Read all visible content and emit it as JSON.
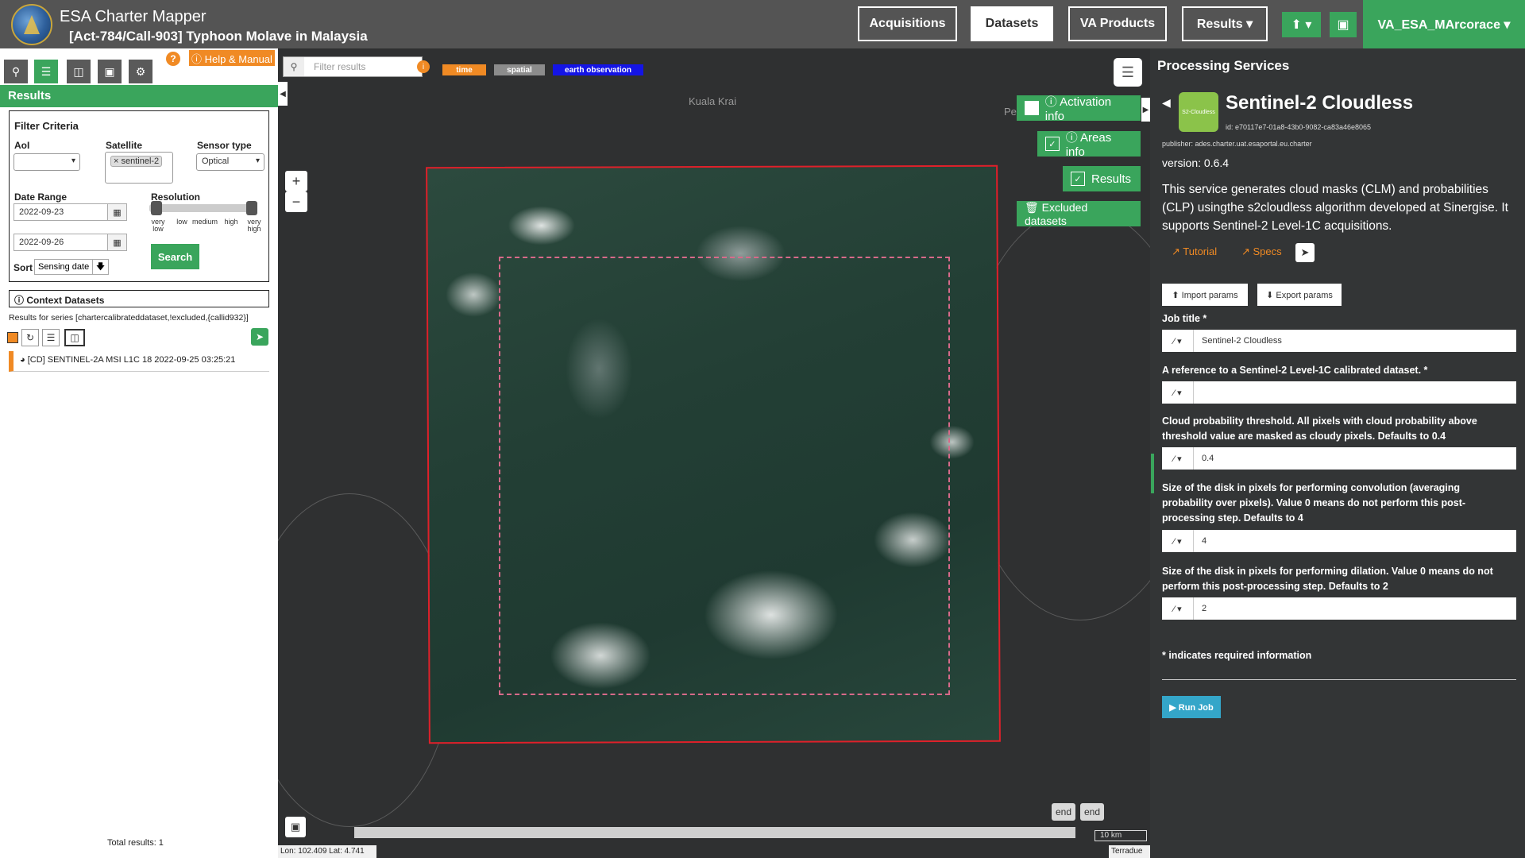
{
  "header": {
    "app_title": "ESA Charter Mapper",
    "subtitle": "[Act-784/Call-903] Typhoon Molave in Malaysia",
    "nav": {
      "acquisitions": "Acquisitions",
      "datasets": "Datasets",
      "va_products": "VA Products",
      "results": "Results ▾"
    },
    "upload_icon": "⬆ ▾",
    "briefcase_icon": "▣",
    "user": "VA_ESA_MArcorace ▾"
  },
  "left": {
    "help_q": "?",
    "help_label": "ⓘ Help & Manual",
    "results_title": "Results",
    "filter": {
      "title": "Filter Criteria",
      "aoi_label": "AoI",
      "aoi_value": "",
      "satellite_label": "Satellite",
      "satellite_chip": "× sentinel-2",
      "sensor_label": "Sensor type",
      "sensor_value": "Optical",
      "date_label": "Date Range",
      "date_from": "2022-09-23",
      "date_to": "2022-09-26",
      "resolution_label": "Resolution",
      "ticks": [
        "very low",
        "low",
        "medium",
        "high",
        "very high"
      ],
      "search_label": "Search",
      "sort_label": "Sort",
      "sort_value": "Sensing date"
    },
    "context_label": "ⓘ Context Datasets",
    "series_text": "Results for series [chartercalibrateddataset,!excluded,{callid932}]",
    "result_item": "◕ [CD] SENTINEL-2A MSI L1C 18 2022-09-25 03:25:21",
    "total": "Total results: 1"
  },
  "map": {
    "filter_placeholder": "Filter results",
    "tags": [
      {
        "label": "time",
        "color": "#f08a24"
      },
      {
        "label": "spatial",
        "color": "#8c8c8c"
      },
      {
        "label": "earth observation",
        "color": "#1414e6"
      }
    ],
    "activation_info": "ⓘ Activation info",
    "areas_info": "ⓘ Areas info",
    "results_btn": "Results",
    "excluded": "🗑 Excluded datasets",
    "place1": "Kuala Krai",
    "place2": "Pe",
    "end1": "end",
    "end2": "end",
    "scale": "10 km",
    "coords": "Lon: 102.409 Lat: 4.741",
    "attribution": "Terradue"
  },
  "right": {
    "heading": "Processing Services",
    "service_logo": "S2-Cloudless",
    "service_title": "Sentinel-2 Cloudless",
    "service_id": "id: e70117e7-01a8-43b0-9082-ca83a46e8065",
    "publisher": "publisher: ades.charter.uat.esaportal.eu.charter",
    "version": "version: 0.6.4",
    "description": "This service generates cloud masks (CLM) and probabilities (CLP) usingthe s2cloudless algorithm developed at Sinergise. It supports Sentinel-2 Level-1C acquisitions.",
    "tutorial": "↗ Tutorial",
    "specs": "↗ Specs",
    "import_params": "⬆ Import params",
    "export_params": "⬇ Export params",
    "fields": [
      {
        "label": "Job title *",
        "value": "Sentinel-2 Cloudless"
      },
      {
        "label": "A reference to a Sentinel-2 Level-1C calibrated dataset. *",
        "value": ""
      },
      {
        "label": "Cloud probability threshold. All pixels with cloud probability above threshold value are masked as cloudy pixels. Defaults to 0.4",
        "value": "0.4"
      },
      {
        "label": "Size of the disk in pixels for performing convolution (averaging probability over pixels). Value 0 means do not perform this post-processing step. Defaults to 4",
        "value": "4"
      },
      {
        "label": "Size of the disk in pixels for performing dilation. Value 0 means do not perform this post-processing step. Defaults to 2",
        "value": "2"
      }
    ],
    "wand": "⁄ ▾",
    "required_note": "* indicates required information",
    "run_job": "▶ Run Job"
  }
}
